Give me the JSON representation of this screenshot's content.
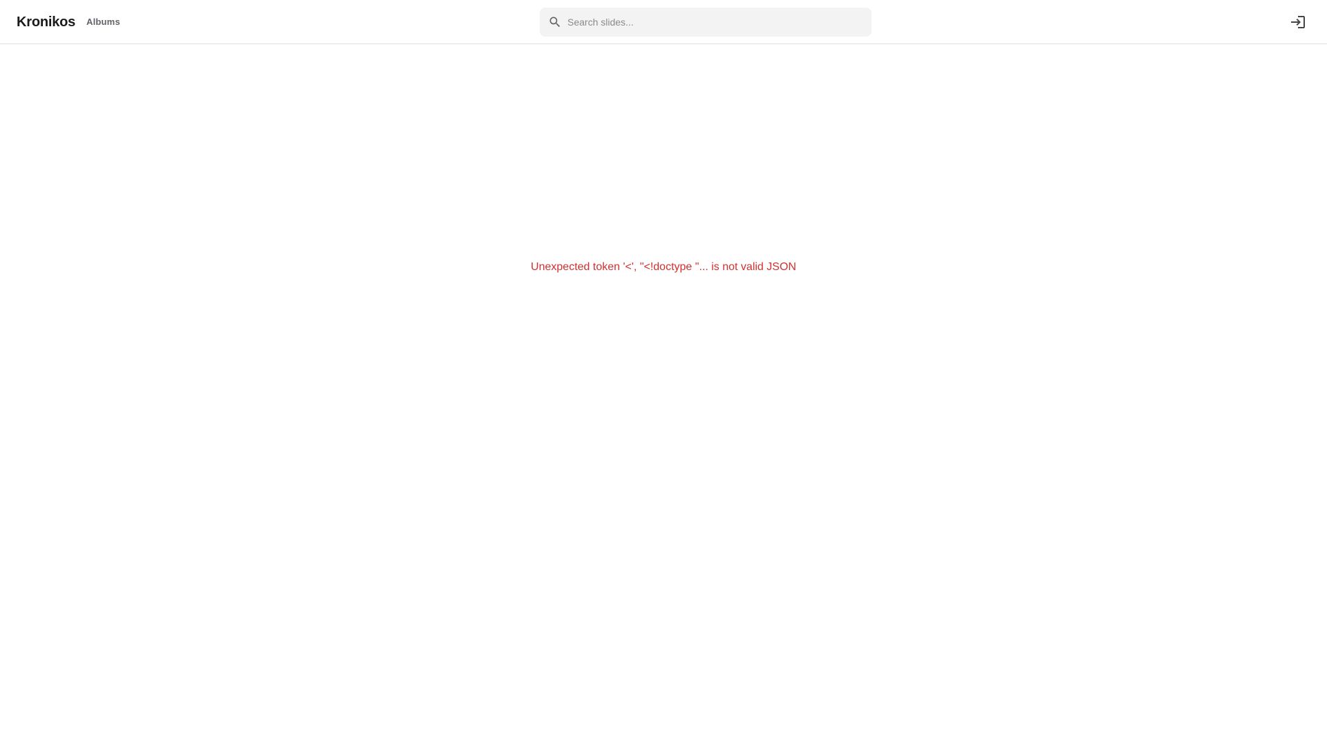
{
  "header": {
    "brand": "Kronikos",
    "nav": {
      "albums_label": "Albums"
    },
    "search": {
      "placeholder": "Search slides...",
      "value": "",
      "icon": "search-icon"
    },
    "login": {
      "icon": "login-icon"
    }
  },
  "main": {
    "error_text": "Unexpected token '<', \"<!doctype \"... is not valid JSON"
  },
  "colors": {
    "error": "#d32f2f",
    "search_bg": "#f3f3f3",
    "divider": "#e0e0e0"
  }
}
